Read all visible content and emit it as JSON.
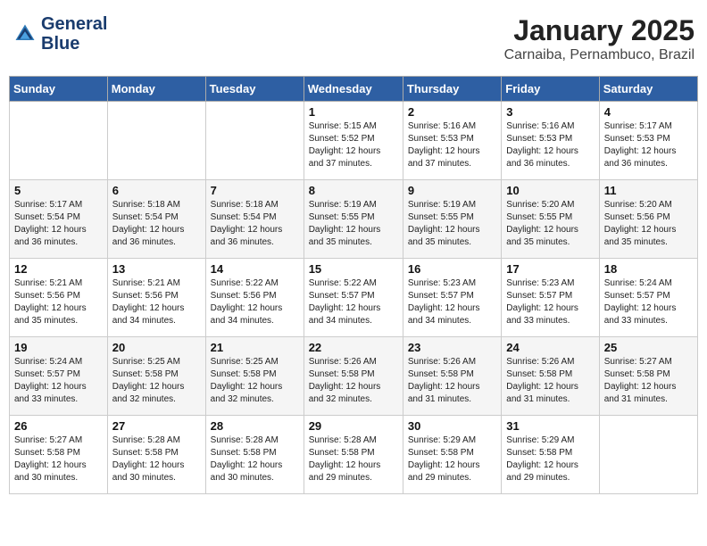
{
  "header": {
    "logo_line1": "General",
    "logo_line2": "Blue",
    "month": "January 2025",
    "location": "Carnaiba, Pernambuco, Brazil"
  },
  "days_of_week": [
    "Sunday",
    "Monday",
    "Tuesday",
    "Wednesday",
    "Thursday",
    "Friday",
    "Saturday"
  ],
  "weeks": [
    [
      {
        "day": "",
        "info": ""
      },
      {
        "day": "",
        "info": ""
      },
      {
        "day": "",
        "info": ""
      },
      {
        "day": "1",
        "info": "Sunrise: 5:15 AM\nSunset: 5:52 PM\nDaylight: 12 hours\nand 37 minutes."
      },
      {
        "day": "2",
        "info": "Sunrise: 5:16 AM\nSunset: 5:53 PM\nDaylight: 12 hours\nand 37 minutes."
      },
      {
        "day": "3",
        "info": "Sunrise: 5:16 AM\nSunset: 5:53 PM\nDaylight: 12 hours\nand 36 minutes."
      },
      {
        "day": "4",
        "info": "Sunrise: 5:17 AM\nSunset: 5:53 PM\nDaylight: 12 hours\nand 36 minutes."
      }
    ],
    [
      {
        "day": "5",
        "info": "Sunrise: 5:17 AM\nSunset: 5:54 PM\nDaylight: 12 hours\nand 36 minutes."
      },
      {
        "day": "6",
        "info": "Sunrise: 5:18 AM\nSunset: 5:54 PM\nDaylight: 12 hours\nand 36 minutes."
      },
      {
        "day": "7",
        "info": "Sunrise: 5:18 AM\nSunset: 5:54 PM\nDaylight: 12 hours\nand 36 minutes."
      },
      {
        "day": "8",
        "info": "Sunrise: 5:19 AM\nSunset: 5:55 PM\nDaylight: 12 hours\nand 35 minutes."
      },
      {
        "day": "9",
        "info": "Sunrise: 5:19 AM\nSunset: 5:55 PM\nDaylight: 12 hours\nand 35 minutes."
      },
      {
        "day": "10",
        "info": "Sunrise: 5:20 AM\nSunset: 5:55 PM\nDaylight: 12 hours\nand 35 minutes."
      },
      {
        "day": "11",
        "info": "Sunrise: 5:20 AM\nSunset: 5:56 PM\nDaylight: 12 hours\nand 35 minutes."
      }
    ],
    [
      {
        "day": "12",
        "info": "Sunrise: 5:21 AM\nSunset: 5:56 PM\nDaylight: 12 hours\nand 35 minutes."
      },
      {
        "day": "13",
        "info": "Sunrise: 5:21 AM\nSunset: 5:56 PM\nDaylight: 12 hours\nand 34 minutes."
      },
      {
        "day": "14",
        "info": "Sunrise: 5:22 AM\nSunset: 5:56 PM\nDaylight: 12 hours\nand 34 minutes."
      },
      {
        "day": "15",
        "info": "Sunrise: 5:22 AM\nSunset: 5:57 PM\nDaylight: 12 hours\nand 34 minutes."
      },
      {
        "day": "16",
        "info": "Sunrise: 5:23 AM\nSunset: 5:57 PM\nDaylight: 12 hours\nand 34 minutes."
      },
      {
        "day": "17",
        "info": "Sunrise: 5:23 AM\nSunset: 5:57 PM\nDaylight: 12 hours\nand 33 minutes."
      },
      {
        "day": "18",
        "info": "Sunrise: 5:24 AM\nSunset: 5:57 PM\nDaylight: 12 hours\nand 33 minutes."
      }
    ],
    [
      {
        "day": "19",
        "info": "Sunrise: 5:24 AM\nSunset: 5:57 PM\nDaylight: 12 hours\nand 33 minutes."
      },
      {
        "day": "20",
        "info": "Sunrise: 5:25 AM\nSunset: 5:58 PM\nDaylight: 12 hours\nand 32 minutes."
      },
      {
        "day": "21",
        "info": "Sunrise: 5:25 AM\nSunset: 5:58 PM\nDaylight: 12 hours\nand 32 minutes."
      },
      {
        "day": "22",
        "info": "Sunrise: 5:26 AM\nSunset: 5:58 PM\nDaylight: 12 hours\nand 32 minutes."
      },
      {
        "day": "23",
        "info": "Sunrise: 5:26 AM\nSunset: 5:58 PM\nDaylight: 12 hours\nand 31 minutes."
      },
      {
        "day": "24",
        "info": "Sunrise: 5:26 AM\nSunset: 5:58 PM\nDaylight: 12 hours\nand 31 minutes."
      },
      {
        "day": "25",
        "info": "Sunrise: 5:27 AM\nSunset: 5:58 PM\nDaylight: 12 hours\nand 31 minutes."
      }
    ],
    [
      {
        "day": "26",
        "info": "Sunrise: 5:27 AM\nSunset: 5:58 PM\nDaylight: 12 hours\nand 30 minutes."
      },
      {
        "day": "27",
        "info": "Sunrise: 5:28 AM\nSunset: 5:58 PM\nDaylight: 12 hours\nand 30 minutes."
      },
      {
        "day": "28",
        "info": "Sunrise: 5:28 AM\nSunset: 5:58 PM\nDaylight: 12 hours\nand 30 minutes."
      },
      {
        "day": "29",
        "info": "Sunrise: 5:28 AM\nSunset: 5:58 PM\nDaylight: 12 hours\nand 29 minutes."
      },
      {
        "day": "30",
        "info": "Sunrise: 5:29 AM\nSunset: 5:58 PM\nDaylight: 12 hours\nand 29 minutes."
      },
      {
        "day": "31",
        "info": "Sunrise: 5:29 AM\nSunset: 5:58 PM\nDaylight: 12 hours\nand 29 minutes."
      },
      {
        "day": "",
        "info": ""
      }
    ]
  ]
}
